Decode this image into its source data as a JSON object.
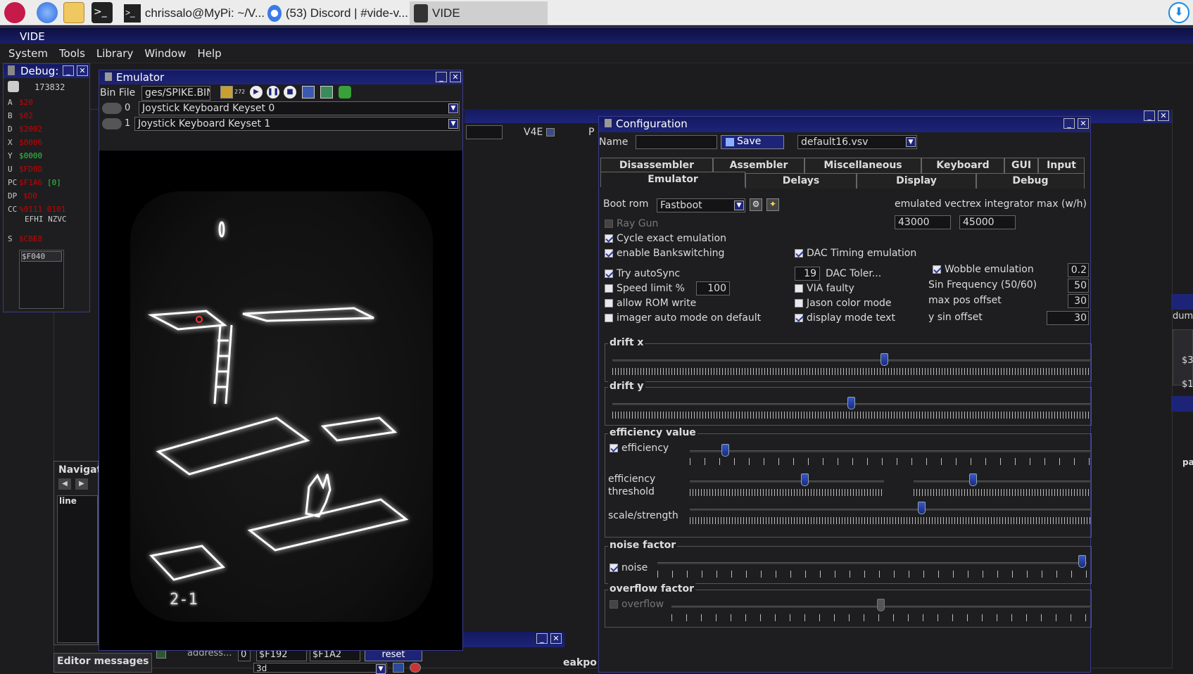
{
  "taskbar": {
    "tasks": [
      {
        "label": "chrissalo@MyPi: ~/V..."
      },
      {
        "label": "(53) Discord | #vide-v..."
      },
      {
        "label": "VIDE"
      }
    ]
  },
  "app": {
    "title": "VIDE"
  },
  "menu": [
    "System",
    "Tools",
    "Library",
    "Window",
    "Help"
  ],
  "debug": {
    "title": "Debug:",
    "cycles": "173832",
    "registers": [
      {
        "name": "A",
        "value": "$20"
      },
      {
        "name": "B",
        "value": "$02"
      },
      {
        "name": "D",
        "value": "$2002"
      },
      {
        "name": "X",
        "value": "$0006"
      },
      {
        "name": "Y",
        "value": "$0000"
      },
      {
        "name": "U",
        "value": "$FD0D"
      },
      {
        "name": "PC",
        "value": "$F1A6",
        "extra": "[0]"
      },
      {
        "name": "DP",
        "value": "$D0"
      },
      {
        "name": "CC",
        "value": "%0111 0101",
        "flags": "EFHI NZVC"
      },
      {
        "name": "S",
        "value": "$CBE8"
      }
    ],
    "stack_value": "$F040"
  },
  "emulator": {
    "title": "Emulator",
    "bin_label": "Bin File",
    "bin_value": "ges/SPIKE.BIN",
    "counter": "272",
    "joysticks": [
      {
        "index": "0",
        "value": "Joystick Keyboard Keyset 0"
      },
      {
        "index": "1",
        "value": "Joystick Keyboard Keyset 1"
      }
    ],
    "screen_text": "2-1"
  },
  "background": {
    "v4e_label": "V4E",
    "p_label": "P",
    "navigator_title": "Navigat",
    "nav_col": "line",
    "editor_messages": "Editor messages",
    "addr_label": "address...",
    "addr_field": "0",
    "addr_value1": "$F192",
    "addr_value2": "$F1A2",
    "reset_label": "reset",
    "mode_value": "3d",
    "breakpoint_label": "eakpo",
    "dump_label": "dump",
    "dump_rows": [
      "$3",
      "$1"
    ],
    "pat_label": "pat"
  },
  "config": {
    "title": "Configuration",
    "name_label": "Name",
    "name_value": "",
    "save_label": "Save",
    "file_value": "default16.vsv",
    "tabs_row1": [
      "Disassembler",
      "Assembler",
      "Miscellaneous",
      "Keyboard",
      "GUI",
      "Input"
    ],
    "tabs_row2": [
      "Emulator",
      "Delays",
      "Display",
      "Debug"
    ],
    "boot_rom_label": "Boot rom",
    "boot_rom_value": "Fastboot",
    "integrator_label": "emulated vectrex integrator max (w/h)",
    "integrator_w": "43000",
    "integrator_h": "45000",
    "ray_gun": "Ray Gun",
    "cycle_exact": "Cycle exact emulation",
    "bankswitching": "enable Bankswitching",
    "dac_timing": "DAC Timing emulation",
    "try_autosync": "Try autoSync",
    "dac_toler_value": "19",
    "dac_toler_label": "DAC Toler...",
    "wobble": "Wobble emulation",
    "wobble_value": "0.2",
    "speed_limit": "Speed limit %",
    "speed_value": "100",
    "via_faulty": "VIA faulty",
    "sin_freq_label": "Sin Frequency (50/60)",
    "sin_freq_value": "50",
    "allow_rom_write": "allow ROM write",
    "jason_color": "Jason color mode",
    "max_pos_label": "max pos offset",
    "max_pos_value": "30",
    "imager_auto": "imager auto mode on default",
    "display_mode_text": "display mode text",
    "y_sin_label": "y sin offset",
    "y_sin_value": "30",
    "drift_x_title": "drift x",
    "drift_x_level": 0.57,
    "drift_y_title": "drift y",
    "drift_y_level": 0.5,
    "efficiency_group": "efficiency value",
    "efficiency_label": "efficiency",
    "efficiency_level": 0.08,
    "threshold_label1": "efficiency",
    "threshold_label2": "threshold",
    "threshold_level_a": 0.6,
    "threshold_level_b": 0.33,
    "scale_label": "scale/strength",
    "scale_level": 0.58,
    "noise_group": "noise factor",
    "noise_label": "noise",
    "noise_level": 1.0,
    "overflow_group": "overflow factor",
    "overflow_label": "overflow",
    "overflow_level": 0.5
  }
}
